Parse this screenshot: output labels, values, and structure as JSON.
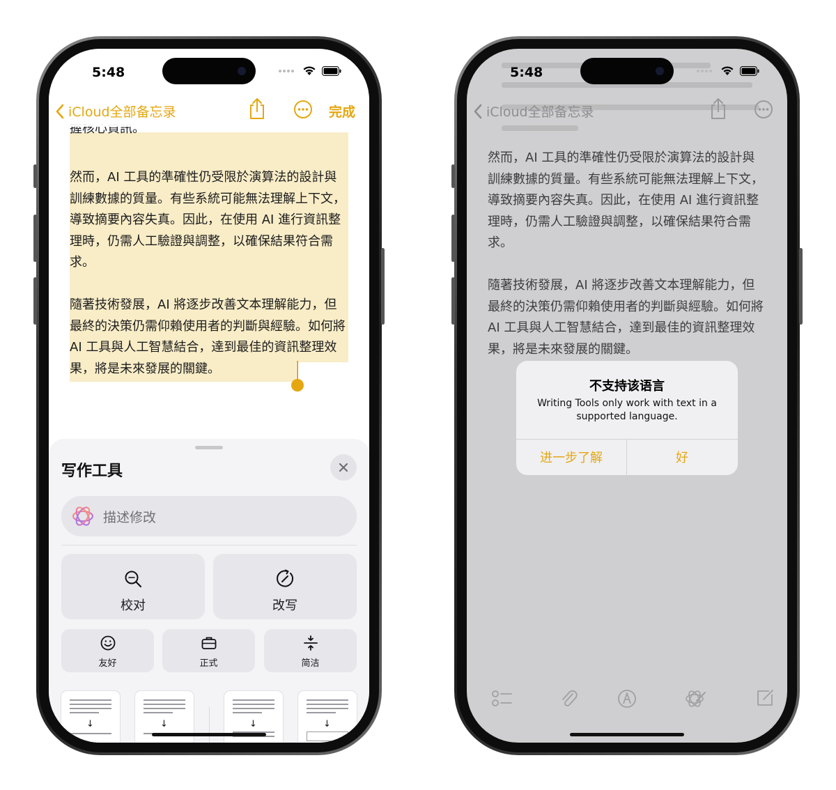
{
  "colors": {
    "accent": "#e5a711",
    "highlight": "#f9edc7",
    "dim_background": "#cfcfd1"
  },
  "left_phone": {
    "status": {
      "time": "5:48"
    },
    "nav": {
      "back_label": "iCloud全部备忘录",
      "done_label": "完成",
      "share_icon": "share-icon",
      "more_icon": "ellipsis-circle-icon"
    },
    "note": {
      "partial_line": "握核心資訊。",
      "paragraphs": [
        "然而，AI 工具的準確性仍受限於演算法的設計與訓練數據的質量。有些系統可能無法理解上下文，導致摘要內容失真。因此，在使用 AI 進行資訊整理時，仍需人工驗證與調整，以確保結果符合需求。",
        "隨著技術發展，AI 將逐步改善文本理解能力，但最終的決策仍需仰賴使用者的判斷與經驗。如何將 AI 工具與人工智慧結合，達到最佳的資訊整理效果，將是未來發展的關鍵。"
      ]
    },
    "writing_tools": {
      "title": "写作工具",
      "describe_placeholder": "描述修改",
      "tools_big": [
        {
          "label": "校对",
          "icon": "magnifier-icon"
        },
        {
          "label": "改写",
          "icon": "rewrite-icon"
        }
      ],
      "tools_small": [
        {
          "label": "友好",
          "icon": "smiley-icon"
        },
        {
          "label": "正式",
          "icon": "briefcase-icon"
        },
        {
          "label": "简洁",
          "icon": "concise-icon"
        }
      ]
    }
  },
  "right_phone": {
    "status": {
      "time": "5:48"
    },
    "nav": {
      "back_label": "iCloud全部备忘录"
    },
    "note": {
      "paragraphs": [
        "然而，AI 工具的準確性仍受限於演算法的設計與訓練數據的質量。有些系統可能無法理解上下文，導致摘要內容失真。因此，在使用 AI 進行資訊整理時，仍需人工驗證與調整，以確保結果符合需求。",
        "隨著技術發展，AI 將逐步改善文本理解能力，但最終的決策仍需仰賴使用者的判斷與經驗。如何將 AI 工具與人工智慧結合，達到最佳的資訊整理效果，將是未來發展的關鍵。"
      ]
    },
    "alert": {
      "title": "不支持该语言",
      "message": "Writing Tools only work with text in a supported language.",
      "learn_more": "进一步了解",
      "ok": "好"
    },
    "toolbar_icons": [
      "checklist-icon",
      "paperclip-icon",
      "markup-icon",
      "writing-tools-icon",
      "compose-icon"
    ]
  }
}
